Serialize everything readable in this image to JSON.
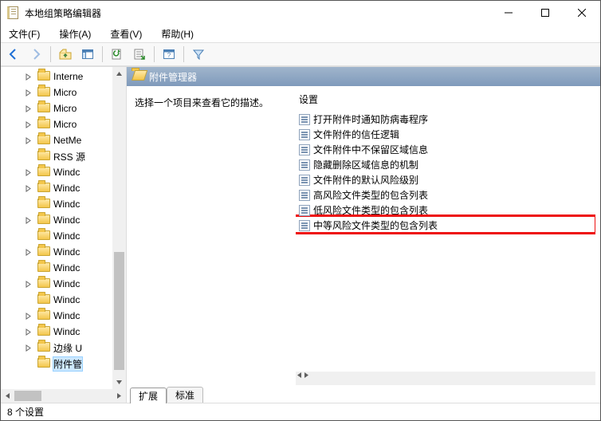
{
  "window": {
    "title": "本地组策略编辑器"
  },
  "menubar": {
    "file": "文件(F)",
    "action": "操作(A)",
    "view": "查看(V)",
    "help": "帮助(H)"
  },
  "toolbar": {
    "back": "back",
    "forward": "forward",
    "up": "up",
    "props": "properties",
    "refresh": "refresh",
    "export": "export",
    "help": "help",
    "filter": "filter"
  },
  "tree": {
    "items": [
      {
        "label": "Interne",
        "expandable": true
      },
      {
        "label": "Micro",
        "expandable": true
      },
      {
        "label": "Micro",
        "expandable": true
      },
      {
        "label": "Micro",
        "expandable": true
      },
      {
        "label": "NetMe",
        "expandable": true
      },
      {
        "label": "RSS 源",
        "expandable": false
      },
      {
        "label": "Windc",
        "expandable": true
      },
      {
        "label": "Windc",
        "expandable": true
      },
      {
        "label": "Windc",
        "expandable": false
      },
      {
        "label": "Windc",
        "expandable": true
      },
      {
        "label": "Windc",
        "expandable": false
      },
      {
        "label": "Windc",
        "expandable": true
      },
      {
        "label": "Windc",
        "expandable": false
      },
      {
        "label": "Windc",
        "expandable": true
      },
      {
        "label": "Windc",
        "expandable": false
      },
      {
        "label": "Windc",
        "expandable": true
      },
      {
        "label": "Windc",
        "expandable": true
      },
      {
        "label": "边缘 U",
        "expandable": true
      },
      {
        "label": "附件管",
        "expandable": false,
        "selected": true
      }
    ]
  },
  "right": {
    "heading": "附件管理器",
    "description_prompt": "选择一个项目来查看它的描述。",
    "column_header": "设置",
    "settings": [
      "打开附件时通知防病毒程序",
      "文件附件的信任逻辑",
      "文件附件中不保留区域信息",
      "隐藏删除区域信息的机制",
      "文件附件的默认风险级别",
      "高风险文件类型的包含列表",
      "低风险文件类型的包含列表",
      "中等风险文件类型的包含列表"
    ],
    "highlighted_index": 7,
    "tabs": {
      "extended": "扩展",
      "standard": "标准"
    }
  },
  "statusbar": {
    "text": "8 个设置"
  }
}
